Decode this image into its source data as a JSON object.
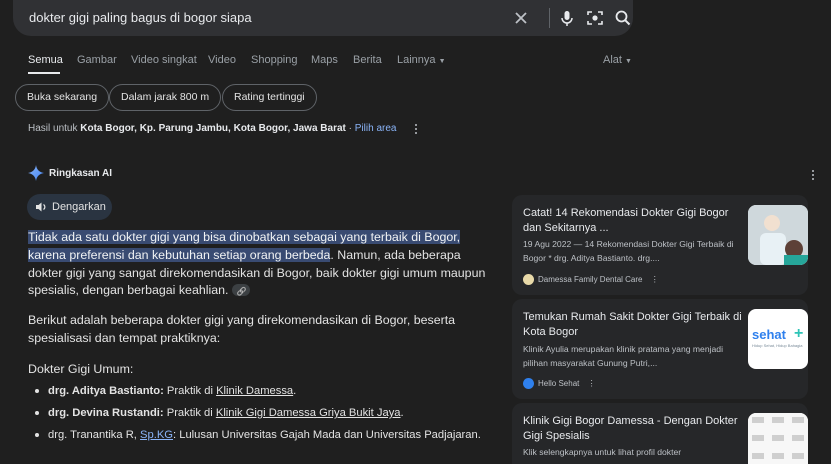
{
  "search": {
    "query": "dokter gigi paling bagus di bogor siapa"
  },
  "tabs": [
    "Semua",
    "Gambar",
    "Video singkat",
    "Video",
    "Shopping",
    "Maps",
    "Berita",
    "Lainnya",
    "Alat"
  ],
  "chips": [
    "Buka sekarang",
    "Dalam jarak 800 m",
    "Rating tertinggi"
  ],
  "location": {
    "prefix": "Hasil untuk",
    "place": "Kota Bogor, Kp. Parung Jambu, Kota Bogor, Jawa Barat",
    "separator": "·",
    "pick": "Pilih area"
  },
  "ai": {
    "title": "Ringkasan AI",
    "listen": "Dengarkan",
    "p1_highlight": "Tidak ada satu dokter gigi yang bisa dinobatkan sebagai yang terbaik di Bogor, karena preferensi dan kebutuhan setiap orang berbeda",
    "p1_rest": ". Namun, ada beberapa dokter gigi yang sangat direkomendasikan di Bogor, baik dokter gigi umum maupun spesialis, dengan berbagai keahlian.",
    "p2": "Berikut adalah beberapa dokter gigi yang direkomendasikan di Bogor, beserta spesialisasi dan tempat praktiknya:",
    "p3": "Dokter Gigi Umum:",
    "list": [
      {
        "name": "drg. Aditya Bastianto:",
        "text": " Praktik di ",
        "link": "Klinik Damessa",
        "end": "."
      },
      {
        "name": "drg. Devina Rustandi:",
        "text": " Praktik di ",
        "link": "Klinik Gigi Damessa Griya Bukit Jaya",
        "end": "."
      },
      {
        "name": "drg. Tranantika R, ",
        "link": "Sp.KG",
        "text": ": Lulusan Universitas Gajah Mada dan Universitas Padjajaran."
      }
    ]
  },
  "cards": [
    {
      "title": "Catat! 14 Rekomendasi Dokter Gigi Bogor dan Sekitarnya ...",
      "snippet": "19 Agu 2022 — 14 Rekomendasi Dokter Gigi Terbaik di Bogor * drg. Aditya Bastianto. drg....",
      "source": "Damessa Family Dental Care"
    },
    {
      "title": "Temukan Rumah Sakit Dokter Gigi Terbaik di Kota Bogor",
      "snippet": "Klinik Ayulia merupakan klinik pratama yang menjadi pilihan masyarakat Gunung Putri,...",
      "source": "Hello Sehat",
      "thumb_text": "sehat",
      "thumb_sub": "Hidup Sehat, Hidup Bahagia"
    },
    {
      "title": "Klinik Gigi Bogor Damessa - Dengan Dokter Gigi Spesialis",
      "snippet": "Klik selengkapnya untuk lihat profil dokter"
    }
  ],
  "colors": {
    "accent": "#8ab4f8",
    "highlight": "#394b72",
    "background": "#1f1f1f"
  }
}
